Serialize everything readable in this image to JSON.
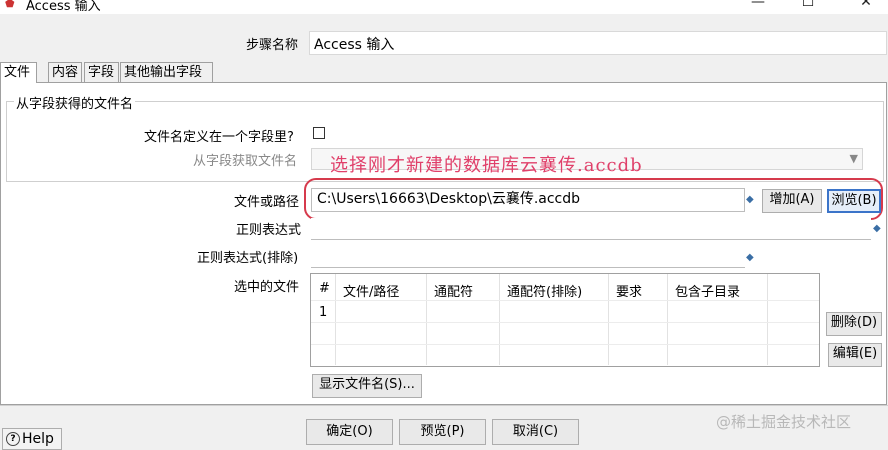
{
  "window": {
    "title": "Access 输入",
    "minimize_glyph": "—",
    "maximize_glyph": "☐",
    "close_glyph": "✕",
    "icon": "access-app-icon"
  },
  "step": {
    "label": "步骤名称",
    "value": "Access 输入"
  },
  "tabs": [
    {
      "label": "文件",
      "active": true
    },
    {
      "label": "内容"
    },
    {
      "label": "字段"
    },
    {
      "label": "其他输出字段"
    }
  ],
  "group": {
    "title": "从字段获得的文件名",
    "filename_in_field_label": "文件名定义在一个字段里?",
    "filename_in_field_checked": false,
    "get_filename_from_field_label": "从字段获取文件名",
    "get_filename_from_field_value": ""
  },
  "annotation": "选择刚才新建的数据库云襄传.accdb",
  "form": {
    "file_or_dir_label": "文件或路径",
    "file_or_dir_value": "C:\\Users\\16663\\Desktop\\云襄传.accdb",
    "add_button": "增加(A)",
    "browse_button": "浏览(B)",
    "regex_label": "正则表达式",
    "regex_value": "",
    "regex_exclude_label": "正则表达式(排除)",
    "regex_exclude_value": "",
    "selected_files_label": "选中的文件",
    "delete_button": "删除(D)",
    "edit_button": "编辑(E)",
    "show_filenames_button": "显示文件名(S)..."
  },
  "table": {
    "columns": [
      "#",
      "文件/路径",
      "通配符",
      "通配符(排除)",
      "要求",
      "包含子目录"
    ],
    "rows": [
      [
        "1",
        "",
        "",
        "",
        "",
        ""
      ]
    ]
  },
  "footer": {
    "ok_button": "确定(O)",
    "preview_button": "预览(P)",
    "cancel_button": "取消(C)",
    "help_button": "Help",
    "watermark": "@稀土掘金技术社区"
  },
  "colors": {
    "annotation": "#e0406a",
    "highlight_border": "#d63a4c"
  }
}
